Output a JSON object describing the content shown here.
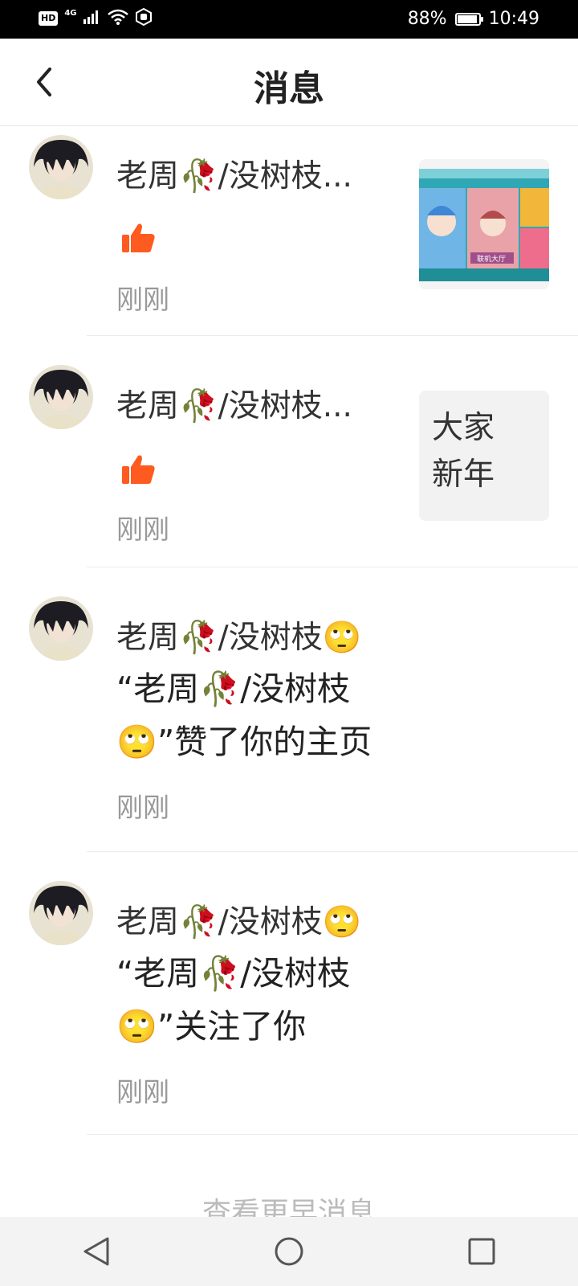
{
  "status_bar": {
    "battery": "88%",
    "time": "10:49",
    "network": "4G",
    "hd": "HD"
  },
  "header": {
    "title": "消息"
  },
  "messages": [
    {
      "name": "老周🥀/没树枝...",
      "type": "like",
      "time": "刚刚",
      "thumb": {
        "kind": "image",
        "labels": [
          "联机大厅"
        ]
      }
    },
    {
      "name": "老周🥀/没树枝...",
      "type": "like",
      "time": "刚刚",
      "thumb": {
        "kind": "text",
        "line1": "大家",
        "line2": "新年"
      }
    },
    {
      "name": "老周🥀/没树枝🙄",
      "type": "text",
      "text": "“老周🥀/没树枝🙄”赞了你的主页",
      "time": "刚刚"
    },
    {
      "name": "老周🥀/没树枝🙄",
      "type": "text",
      "text": "“老周🥀/没树枝🙄”关注了你",
      "time": "刚刚"
    }
  ],
  "more_link": "查看更早消息",
  "colors": {
    "accent_like": "#ff5a1f",
    "time_text": "#999999",
    "divider": "#ececec"
  }
}
